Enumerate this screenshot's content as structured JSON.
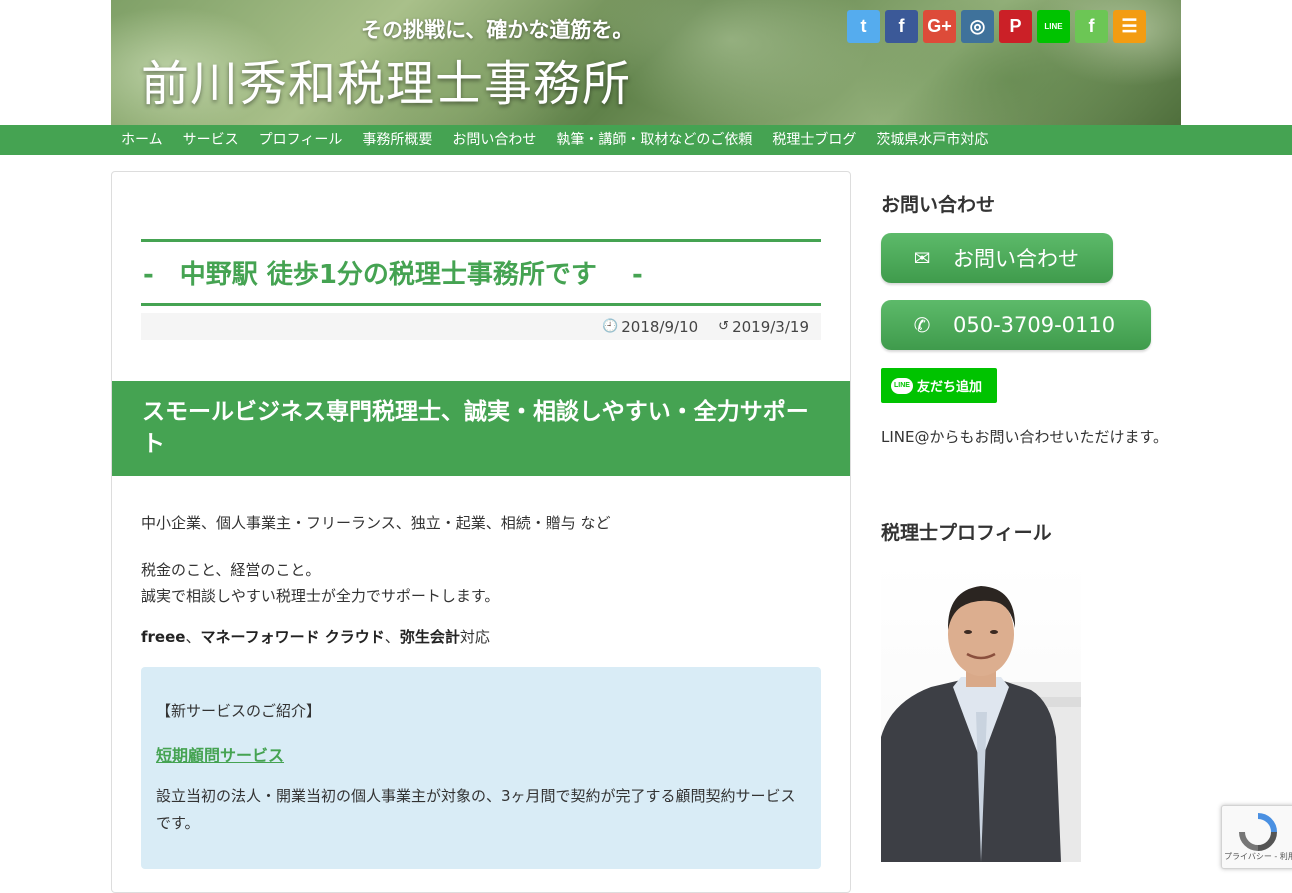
{
  "header": {
    "tagline": "その挑戦に、確かな道筋を。",
    "site_title": "前川秀和税理士事務所",
    "social": [
      {
        "name": "twitter",
        "glyph": "t",
        "color": "#55acee"
      },
      {
        "name": "facebook",
        "glyph": "f",
        "color": "#3b5998"
      },
      {
        "name": "google-plus",
        "glyph": "G+",
        "color": "#dd4b39"
      },
      {
        "name": "instagram",
        "glyph": "◎",
        "color": "#3f729b"
      },
      {
        "name": "pinterest",
        "glyph": "P",
        "color": "#cb2027"
      },
      {
        "name": "line",
        "glyph": "LINE",
        "color": "#00c300"
      },
      {
        "name": "feedly",
        "glyph": "f",
        "color": "#6cc655"
      },
      {
        "name": "rss",
        "glyph": "☰",
        "color": "#f39c12"
      }
    ]
  },
  "nav": {
    "items": [
      "ホーム",
      "サービス",
      "プロフィール",
      "事務所概要",
      "お問い合わせ",
      "執筆・講師・取材などのご依頼",
      "税理士ブログ",
      "茨城県水戸市対応"
    ]
  },
  "article": {
    "title": "-　中野駅 徒歩1分の税理士事務所です　 -",
    "published": "2018/9/10",
    "updated": "2019/3/19",
    "heading": "スモールビジネス専門税理士、誠実・相談しやすい・全力サポート",
    "p1": "中小企業、個人事業主・フリーランス、独立・起業、相続・贈与 など",
    "p2_line1": "税金のこと、経営のこと。",
    "p2_line2": "誠実で相談しやすい税理士が全力でサポートします。",
    "p3": {
      "freee": "freee",
      "sep1": "、",
      "mf": "マネーフォワード クラウド",
      "sep2": "、",
      "yayoi": "弥生会計",
      "suffix": "対応"
    },
    "infobox": {
      "head": "【新サービスのご紹介】",
      "link": "短期顧問サービス",
      "desc": "設立当初の法人・開業当初の個人事業主が対象の、3ヶ月間で契約が完了する顧問契約サービスです。"
    }
  },
  "sidebar": {
    "contact_heading": "お問い合わせ",
    "contact_button": "お問い合わせ",
    "phone_button": "050-3709-0110",
    "line_add_label": "友だち追加",
    "line_badge": "LINE",
    "line_note": "LINE@からもお問い合わせいただけます。",
    "profile_heading": "税理士プロフィール"
  },
  "recaptcha": {
    "text": "プライバシー - 利用規約"
  }
}
